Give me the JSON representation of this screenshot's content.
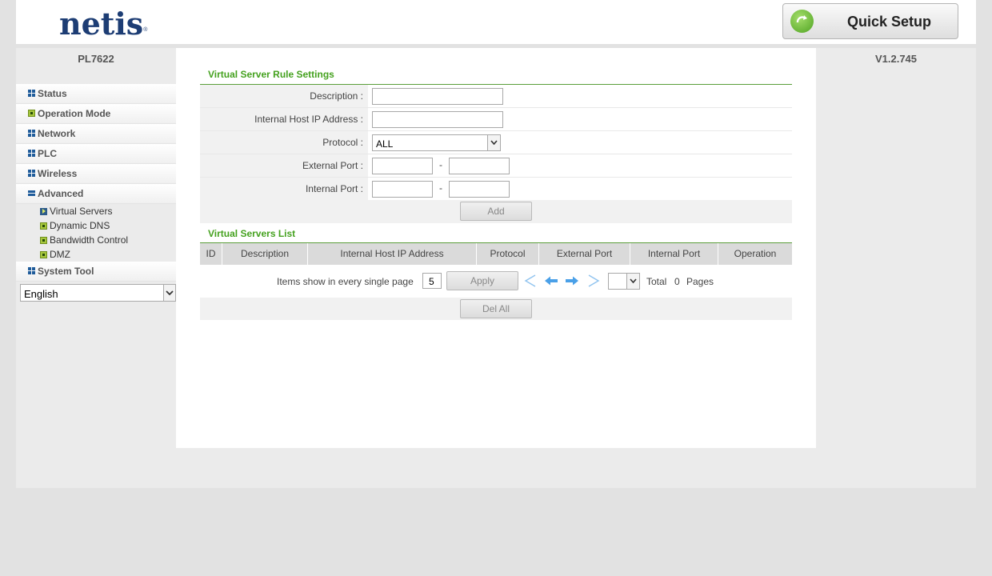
{
  "header": {
    "logo_text": "netis",
    "logo_mark": "®",
    "quick_setup_label": "Quick Setup",
    "quick_setup_icon": "refresh-arrow-icon"
  },
  "sidebar": {
    "model": "PL7622",
    "items": [
      {
        "label": "Status",
        "icon": "grid-icon"
      },
      {
        "label": "Operation Mode",
        "icon": "box-icon"
      },
      {
        "label": "Network",
        "icon": "grid-icon"
      },
      {
        "label": "PLC",
        "icon": "grid-icon"
      },
      {
        "label": "Wireless",
        "icon": "grid-icon"
      },
      {
        "label": "Advanced",
        "icon": "minus-icon"
      }
    ],
    "advanced_sub": [
      {
        "label": "Virtual Servers",
        "icon": "arrow-icon",
        "active": true
      },
      {
        "label": "Dynamic DNS",
        "icon": "box-icon"
      },
      {
        "label": "Bandwidth Control",
        "icon": "box-icon"
      },
      {
        "label": "DMZ",
        "icon": "box-icon"
      }
    ],
    "system_tool": {
      "label": "System Tool",
      "icon": "grid-icon"
    },
    "language": "English"
  },
  "version": "V1.2.745",
  "rule_settings": {
    "title": "Virtual Server Rule Settings",
    "description_label": "Description :",
    "description_value": "",
    "host_ip_label": "Internal Host IP Address :",
    "host_ip_value": "",
    "protocol_label": "Protocol :",
    "protocol_value": "ALL",
    "external_port_label": "External Port :",
    "external_port_from": "",
    "external_port_to": "",
    "internal_port_label": "Internal Port :",
    "internal_port_from": "",
    "internal_port_to": "",
    "range_separator": "-",
    "add_label": "Add"
  },
  "servers_list": {
    "title": "Virtual Servers List",
    "columns": [
      "ID",
      "Description",
      "Internal Host IP Address",
      "Protocol",
      "External Port",
      "Internal Port",
      "Operation"
    ],
    "rows": [],
    "items_per_page_label": "Items show in every single page",
    "items_per_page": "5",
    "apply_label": "Apply",
    "total_label": "Total",
    "total_pages": "0",
    "pages_label": "Pages",
    "current_page": "",
    "del_all_label": "Del All"
  },
  "colors": {
    "accent_green": "#44a11e",
    "logo_blue": "#1d3d74",
    "nav_blue": "#4aa0e8"
  }
}
